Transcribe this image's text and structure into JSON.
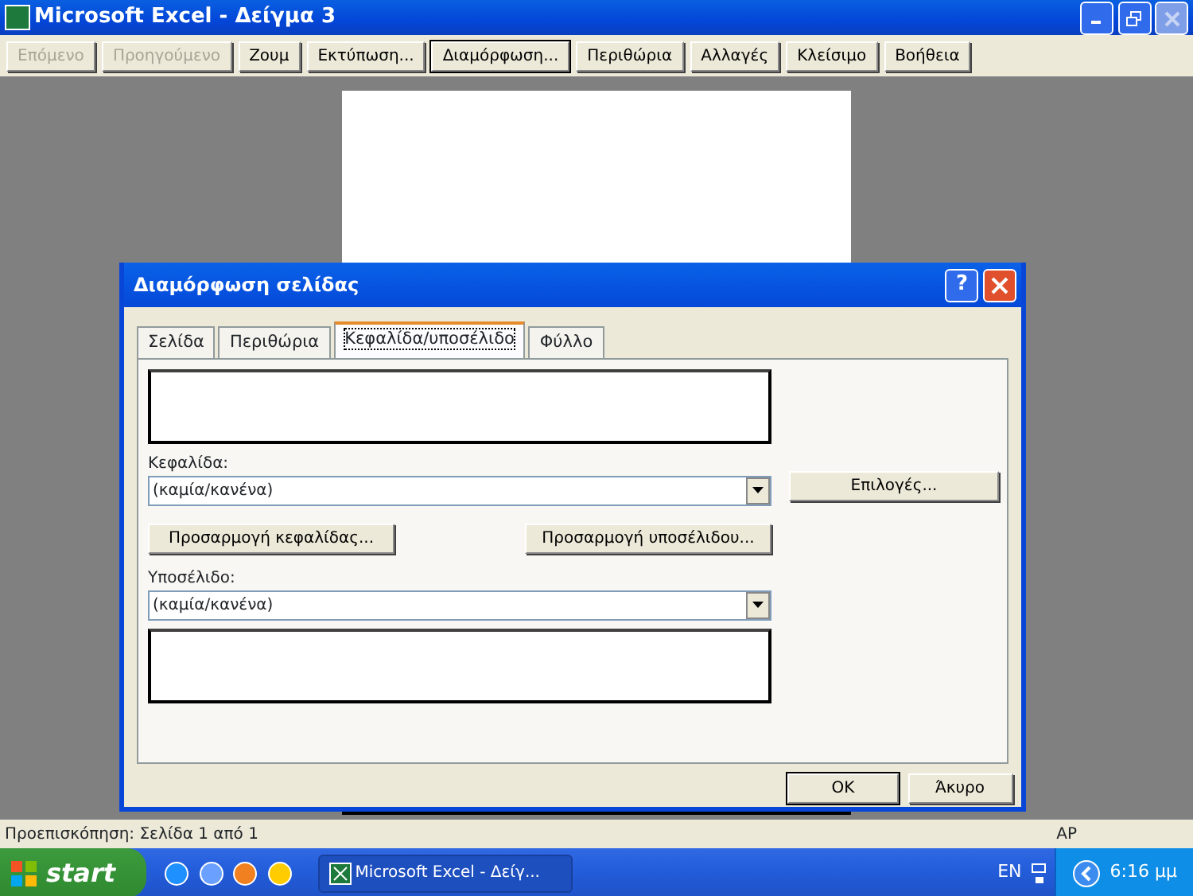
{
  "window": {
    "title": "Microsoft Excel - Δείγμα 3"
  },
  "toolbar": [
    {
      "label": "Επόμενο",
      "disabled": true,
      "selected": false
    },
    {
      "label": "Προηγούμενο",
      "disabled": true,
      "selected": false
    },
    {
      "label": "Ζουμ",
      "disabled": false,
      "selected": false
    },
    {
      "label": "Εκτύπωση...",
      "disabled": false,
      "selected": false
    },
    {
      "label": "Διαμόρφωση...",
      "disabled": false,
      "selected": true
    },
    {
      "label": "Περιθώρια",
      "disabled": false,
      "selected": false
    },
    {
      "label": "Αλλαγές",
      "disabled": false,
      "selected": false
    },
    {
      "label": "Κλείσιμο",
      "disabled": false,
      "selected": false
    },
    {
      "label": "Βοήθεια",
      "disabled": false,
      "selected": false
    }
  ],
  "dialog": {
    "title": "Διαμόρφωση σελίδας",
    "help": "?",
    "tabs": [
      {
        "label": "Σελίδα",
        "selected": false
      },
      {
        "label": "Περιθώρια",
        "selected": false
      },
      {
        "label": "Κεφαλίδα/υποσέλιδο",
        "selected": true
      },
      {
        "label": "Φύλλο",
        "selected": false
      }
    ],
    "header_label": "Κεφαλίδα:",
    "header_value": "(καμία/κανένα)",
    "custom_header": "Προσαρμογή κεφαλίδας...",
    "custom_footer": "Προσαρμογή υποσέλιδου...",
    "footer_label": "Υποσέλιδο:",
    "footer_value": "(καμία/κανένα)",
    "options": "Επιλογές...",
    "ok": "OK",
    "cancel": "Άκυρο"
  },
  "status_bar": {
    "text": "Προεπισκόπηση: Σελίδα 1 από 1",
    "indicator": "ΑΡ"
  },
  "taskbar": {
    "start": "start",
    "task": "Microsoft Excel - Δείγ...",
    "language": "EN",
    "clock": "6:16 μμ"
  }
}
